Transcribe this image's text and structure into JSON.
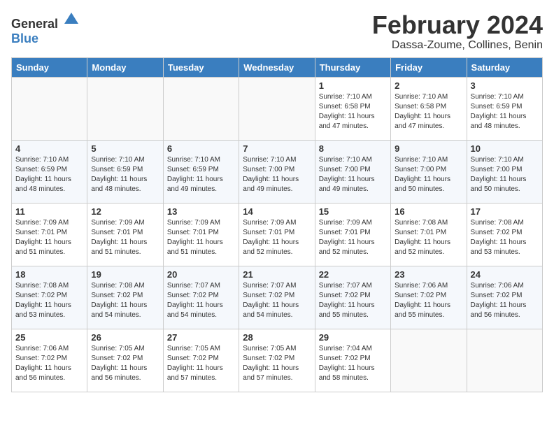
{
  "header": {
    "logo_general": "General",
    "logo_blue": "Blue",
    "title": "February 2024",
    "subtitle": "Dassa-Zoume, Collines, Benin"
  },
  "days_of_week": [
    "Sunday",
    "Monday",
    "Tuesday",
    "Wednesday",
    "Thursday",
    "Friday",
    "Saturday"
  ],
  "weeks": [
    [
      {
        "day": "",
        "info": ""
      },
      {
        "day": "",
        "info": ""
      },
      {
        "day": "",
        "info": ""
      },
      {
        "day": "",
        "info": ""
      },
      {
        "day": "1",
        "info": "Sunrise: 7:10 AM\nSunset: 6:58 PM\nDaylight: 11 hours\nand 47 minutes."
      },
      {
        "day": "2",
        "info": "Sunrise: 7:10 AM\nSunset: 6:58 PM\nDaylight: 11 hours\nand 47 minutes."
      },
      {
        "day": "3",
        "info": "Sunrise: 7:10 AM\nSunset: 6:59 PM\nDaylight: 11 hours\nand 48 minutes."
      }
    ],
    [
      {
        "day": "4",
        "info": "Sunrise: 7:10 AM\nSunset: 6:59 PM\nDaylight: 11 hours\nand 48 minutes."
      },
      {
        "day": "5",
        "info": "Sunrise: 7:10 AM\nSunset: 6:59 PM\nDaylight: 11 hours\nand 48 minutes."
      },
      {
        "day": "6",
        "info": "Sunrise: 7:10 AM\nSunset: 6:59 PM\nDaylight: 11 hours\nand 49 minutes."
      },
      {
        "day": "7",
        "info": "Sunrise: 7:10 AM\nSunset: 7:00 PM\nDaylight: 11 hours\nand 49 minutes."
      },
      {
        "day": "8",
        "info": "Sunrise: 7:10 AM\nSunset: 7:00 PM\nDaylight: 11 hours\nand 49 minutes."
      },
      {
        "day": "9",
        "info": "Sunrise: 7:10 AM\nSunset: 7:00 PM\nDaylight: 11 hours\nand 50 minutes."
      },
      {
        "day": "10",
        "info": "Sunrise: 7:10 AM\nSunset: 7:00 PM\nDaylight: 11 hours\nand 50 minutes."
      }
    ],
    [
      {
        "day": "11",
        "info": "Sunrise: 7:09 AM\nSunset: 7:01 PM\nDaylight: 11 hours\nand 51 minutes."
      },
      {
        "day": "12",
        "info": "Sunrise: 7:09 AM\nSunset: 7:01 PM\nDaylight: 11 hours\nand 51 minutes."
      },
      {
        "day": "13",
        "info": "Sunrise: 7:09 AM\nSunset: 7:01 PM\nDaylight: 11 hours\nand 51 minutes."
      },
      {
        "day": "14",
        "info": "Sunrise: 7:09 AM\nSunset: 7:01 PM\nDaylight: 11 hours\nand 52 minutes."
      },
      {
        "day": "15",
        "info": "Sunrise: 7:09 AM\nSunset: 7:01 PM\nDaylight: 11 hours\nand 52 minutes."
      },
      {
        "day": "16",
        "info": "Sunrise: 7:08 AM\nSunset: 7:01 PM\nDaylight: 11 hours\nand 52 minutes."
      },
      {
        "day": "17",
        "info": "Sunrise: 7:08 AM\nSunset: 7:02 PM\nDaylight: 11 hours\nand 53 minutes."
      }
    ],
    [
      {
        "day": "18",
        "info": "Sunrise: 7:08 AM\nSunset: 7:02 PM\nDaylight: 11 hours\nand 53 minutes."
      },
      {
        "day": "19",
        "info": "Sunrise: 7:08 AM\nSunset: 7:02 PM\nDaylight: 11 hours\nand 54 minutes."
      },
      {
        "day": "20",
        "info": "Sunrise: 7:07 AM\nSunset: 7:02 PM\nDaylight: 11 hours\nand 54 minutes."
      },
      {
        "day": "21",
        "info": "Sunrise: 7:07 AM\nSunset: 7:02 PM\nDaylight: 11 hours\nand 54 minutes."
      },
      {
        "day": "22",
        "info": "Sunrise: 7:07 AM\nSunset: 7:02 PM\nDaylight: 11 hours\nand 55 minutes."
      },
      {
        "day": "23",
        "info": "Sunrise: 7:06 AM\nSunset: 7:02 PM\nDaylight: 11 hours\nand 55 minutes."
      },
      {
        "day": "24",
        "info": "Sunrise: 7:06 AM\nSunset: 7:02 PM\nDaylight: 11 hours\nand 56 minutes."
      }
    ],
    [
      {
        "day": "25",
        "info": "Sunrise: 7:06 AM\nSunset: 7:02 PM\nDaylight: 11 hours\nand 56 minutes."
      },
      {
        "day": "26",
        "info": "Sunrise: 7:05 AM\nSunset: 7:02 PM\nDaylight: 11 hours\nand 56 minutes."
      },
      {
        "day": "27",
        "info": "Sunrise: 7:05 AM\nSunset: 7:02 PM\nDaylight: 11 hours\nand 57 minutes."
      },
      {
        "day": "28",
        "info": "Sunrise: 7:05 AM\nSunset: 7:02 PM\nDaylight: 11 hours\nand 57 minutes."
      },
      {
        "day": "29",
        "info": "Sunrise: 7:04 AM\nSunset: 7:02 PM\nDaylight: 11 hours\nand 58 minutes."
      },
      {
        "day": "",
        "info": ""
      },
      {
        "day": "",
        "info": ""
      }
    ]
  ]
}
